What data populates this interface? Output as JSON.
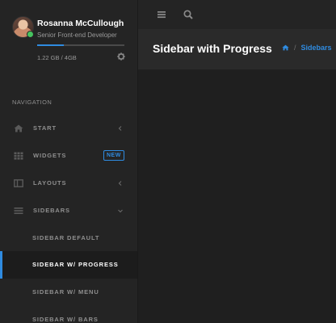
{
  "user": {
    "name": "Rosanna McCullough",
    "role": "Senior Front-end Developer",
    "storage_text": "1.22 GB / 4GB",
    "storage_fraction": 0.305,
    "status": "online"
  },
  "nav": {
    "heading": "NAVIGATION",
    "items": [
      {
        "label": "START",
        "icon": "home-icon"
      },
      {
        "label": "WIDGETS",
        "icon": "grid-icon",
        "badge": "NEW"
      },
      {
        "label": "LAYOUTS",
        "icon": "layout-icon"
      },
      {
        "label": "SIDEBARS",
        "icon": "menu-icon"
      }
    ],
    "sidebar_subitems": [
      {
        "label": "SIDEBAR DEFAULT"
      },
      {
        "label": "SIDEBAR W/ PROGRESS",
        "active": true
      },
      {
        "label": "SIDEBAR W/ MENU"
      },
      {
        "label": "SIDEBAR W/ BARS"
      }
    ]
  },
  "header": {
    "page_title": "Sidebar with Progress",
    "breadcrumb": [
      "home-icon",
      "Sidebars"
    ]
  },
  "colors": {
    "accent": "#2f8be0",
    "online": "#46c35f"
  }
}
